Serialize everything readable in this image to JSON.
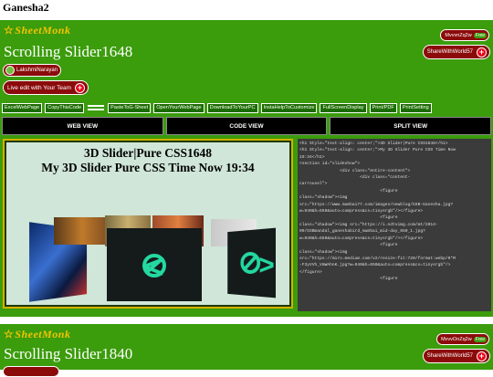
{
  "page": {
    "title": "Ganesha2"
  },
  "card1": {
    "brand": "SheetMonk",
    "brand_star": "☆",
    "title": "Scrolling Slider1648",
    "user": "LakshmiNarayan",
    "live": "Live edit with Your Team",
    "mvvn": "MvvvnZq2w",
    "free": "Free",
    "share": "ShareWithWorld57",
    "toolbar": [
      "ExcelWebPage",
      "CopyThisCode",
      "PasteToG-Sheet",
      "OpenYourWebPage",
      "DownloadToYourPC",
      "InstaHelpToCustomize",
      "FullScreenDisplay",
      "Print/PDF",
      "PrintSetting"
    ],
    "tabs": [
      "WEB VIEW",
      "CODE VIEW",
      "SPLIT VIEW"
    ],
    "preview": {
      "h1": "3D Slider|Pure CSS1648",
      "h2": "My 3D Slider Pure CSS Time Now 19:34"
    },
    "code_lines": [
      "<h1 Style=\"text-align: center;\">3D Slider|Pure CSS1648</h1>",
      "<h1 Style=\"text-align: center;\">My 3D Slider Pure CSS Time Now",
      "19:34</h1>",
      "<section id=\"slideshow\">",
      "                <div class=\"entire-content\">",
      "                        <div class=\"content-",
      "carrousel\">",
      "                                <figure",
      "class=\"shadow\"><img",
      "src=\"https://www.mumbai77.com/images/newblog/GSB-Ganesha.jpg?",
      "w=940&h=650&auto=compress&cs=tinysrgb\"/></figure>",
      "                                <figure",
      "class=\"shadow\"><img src=\"https://i.ndtvimg.com/mt/2014-",
      "09/GSBmandal_ganeshabird_mumbai_mid-day_650_1.jpg?",
      "w=940&h=650&auto=compress&cs=tinysrgb\"/></figure>",
      "                                <figure",
      "class=\"shadow\"><img",
      "src=\"https://miro.medium.com/v2/resize:fit:720/format:webp/0*M",
      "-F3yVVh_VmWAhnK.jpg?w=940&h=650&auto=compress&cs=tinysrgb\"/>",
      "</figure>",
      "                                <figure"
    ]
  },
  "card2": {
    "brand": "SheetMonk",
    "brand_star": "☆",
    "title": "Scrolling Slider1840",
    "mvvn": "MvvvOnZq2w",
    "free": "Free",
    "share": "ShareWithWorld57"
  },
  "colors": {
    "card_bg": "#3b9c0c",
    "brand": "#f4c400",
    "pill": "#8b0b0b",
    "plus": "#e5001a",
    "code_bg": "#3b3b3b"
  }
}
